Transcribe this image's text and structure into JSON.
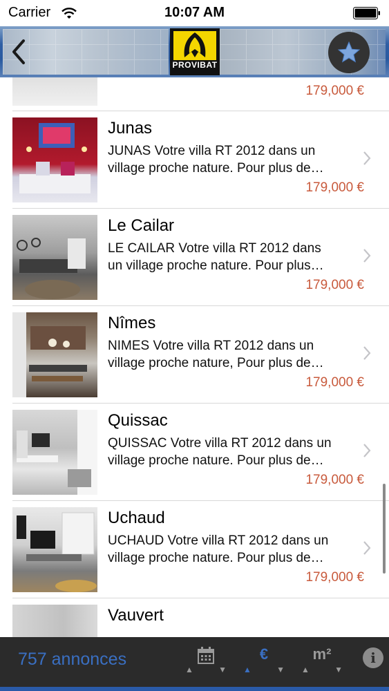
{
  "status_bar": {
    "carrier": "Carrier",
    "time": "10:07 AM"
  },
  "navbar": {
    "logo_text": "PROVIBAT",
    "back_icon": "chevron-left-icon",
    "favorite_icon": "star-icon"
  },
  "listings": [
    {
      "title": "",
      "line1": "",
      "line2": "",
      "price": "179,000 €",
      "thumb": "t-bedroom1"
    },
    {
      "title": "Junas",
      "line1": "JUNAS Votre villa RT 2012 dans un",
      "line2": "village proche nature. Pour plus de…",
      "price": "179,000 €",
      "thumb": "t-junas"
    },
    {
      "title": "Le Cailar",
      "line1": "LE CAILAR Votre villa RT 2012 dans",
      "line2": "un village proche nature. Pour plus…",
      "price": "179,000 €",
      "thumb": "t-cailar"
    },
    {
      "title": "Nîmes",
      "line1": "NIMES Votre villa RT 2012 dans un",
      "line2": "village proche nature, Pour plus de…",
      "price": "179,000 €",
      "thumb": "t-nimes"
    },
    {
      "title": "Quissac",
      "line1": "QUISSAC Votre villa RT 2012 dans un",
      "line2": "village proche nature. Pour plus de…",
      "price": "179,000 €",
      "thumb": "t-quissac"
    },
    {
      "title": "Uchaud",
      "line1": "UCHAUD Votre villa RT 2012 dans un",
      "line2": "village proche nature. Pour plus de…",
      "price": "179,000 €",
      "thumb": "t-uchaud"
    },
    {
      "title": "Vauvert",
      "line1": "",
      "line2": "",
      "price": "",
      "thumb": "t-vauvert"
    }
  ],
  "bottom_bar": {
    "count": "757 annonces",
    "sort_date_icon": "calendar-icon",
    "sort_price_label": "€",
    "sort_area_label": "m²",
    "info_label": "i",
    "up_arrow": "▲",
    "down_arrow": "▼"
  }
}
